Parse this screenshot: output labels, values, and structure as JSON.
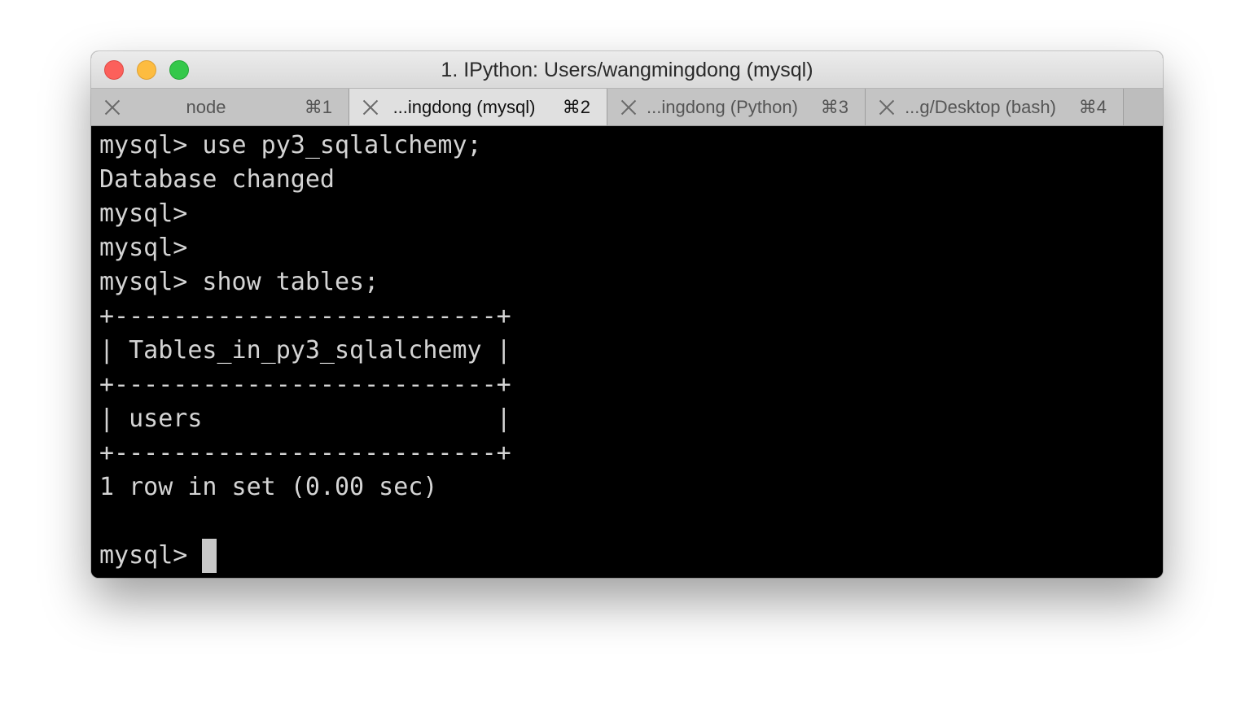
{
  "window": {
    "title": "1. IPython: Users/wangmingdong (mysql)"
  },
  "tabs": [
    {
      "label": "node",
      "shortcut": "⌘1",
      "active": false
    },
    {
      "label": "...ingdong (mysql)",
      "shortcut": "⌘2",
      "active": true
    },
    {
      "label": "...ingdong (Python)",
      "shortcut": "⌘3",
      "active": false
    },
    {
      "label": "...g/Desktop (bash)",
      "shortcut": "⌘4",
      "active": false
    }
  ],
  "terminal": {
    "lines": [
      "mysql> use py3_sqlalchemy;",
      "Database changed",
      "mysql>",
      "mysql>",
      "mysql> show tables;",
      "+--------------------------+",
      "| Tables_in_py3_sqlalchemy |",
      "+--------------------------+",
      "| users                    |",
      "+--------------------------+",
      "1 row in set (0.00 sec)",
      ""
    ],
    "prompt": "mysql> "
  },
  "colors": {
    "terminal_bg": "#000000",
    "terminal_fg": "#d4d4d4",
    "close": "#fc605b",
    "minimize": "#fdbc40",
    "zoom": "#34c84a"
  }
}
